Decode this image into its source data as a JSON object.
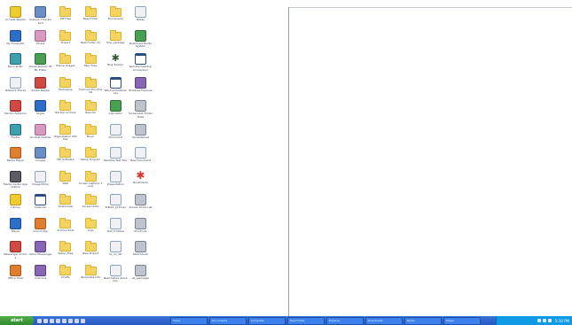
{
  "desktop": {
    "icons": [
      {
        "label": "Acrobat Reader",
        "kind": "yellow"
      },
      {
        "label": "Outlook Thunderbird",
        "kind": "app"
      },
      {
        "label": "ZIP Files",
        "kind": "folder"
      },
      {
        "label": "New Folder",
        "kind": "folder"
      },
      {
        "label": "Documents",
        "kind": "folder"
      },
      {
        "label": "Notes",
        "kind": "doc"
      },
      {
        "label": "My Computer",
        "kind": "blue"
      },
      {
        "label": "Picasa",
        "kind": "pink"
      },
      {
        "label": "Project",
        "kind": "folder"
      },
      {
        "label": "New Folder (2)",
        "kind": "folder"
      },
      {
        "label": "tmp_package",
        "kind": "folder"
      },
      {
        "label": "Download Studio System",
        "kind": "green"
      },
      {
        "label": "Recycle Bin",
        "kind": "teal"
      },
      {
        "label": "Dreamweaver HTML Editor",
        "kind": "green"
      },
      {
        "label": "Online Images",
        "kind": "folder"
      },
      {
        "label": "Misc Files",
        "kind": "folder"
      },
      {
        "label": "Bug Tracker",
        "kind": "bug"
      },
      {
        "label": "Remote Desktop Connection",
        "kind": "window"
      },
      {
        "label": "Network Places",
        "kind": "doc"
      },
      {
        "label": "Adobe Reader",
        "kind": "red"
      },
      {
        "label": "Packaging",
        "kind": "folder"
      },
      {
        "label": "Scanned Documents",
        "kind": "folder"
      },
      {
        "label": "Window Preferences",
        "kind": "window"
      },
      {
        "label": "Windows Explorer",
        "kind": "purple"
      },
      {
        "label": "Norton Antivirus",
        "kind": "red"
      },
      {
        "label": "Skype",
        "kind": "blue"
      },
      {
        "label": "Backup Archive",
        "kind": "folder"
      },
      {
        "label": "Reports",
        "kind": "folder"
      },
      {
        "label": "Calculator",
        "kind": "green"
      },
      {
        "label": "Screenshot Folder Data",
        "kind": "gray"
      },
      {
        "label": "Firefox",
        "kind": "teal"
      },
      {
        "label": "Acrobat Distiller",
        "kind": "pink"
      },
      {
        "label": "Organization Utilities",
        "kind": "folder"
      },
      {
        "label": "Music",
        "kind": "folder"
      },
      {
        "label": "Document",
        "kind": "doc"
      },
      {
        "label": "Spreadsheet",
        "kind": "gray"
      },
      {
        "label": "Media Player",
        "kind": "orange"
      },
      {
        "label": "Images",
        "kind": "app"
      },
      {
        "label": "MP_Software",
        "kind": "folder"
      },
      {
        "label": "Setup Program",
        "kind": "folder"
      },
      {
        "label": "Readme Text Tool",
        "kind": "doc"
      },
      {
        "label": "New Document",
        "kind": "doc"
      },
      {
        "label": "Media Center Application",
        "kind": "dark"
      },
      {
        "label": "Image Editor",
        "kind": "doc"
      },
      {
        "label": "Web",
        "kind": "folder"
      },
      {
        "label": "Screen Capture Tools",
        "kind": "folder"
      },
      {
        "label": "Presentation",
        "kind": "doc"
      },
      {
        "label": "Bookmarks",
        "kind": "star"
      },
      {
        "label": "Library",
        "kind": "yellow"
      },
      {
        "label": "Calendar",
        "kind": "window"
      },
      {
        "label": "Downloads",
        "kind": "folder"
      },
      {
        "label": "Screenshots",
        "kind": "folder"
      },
      {
        "label": "Edited_pictures",
        "kind": "doc"
      },
      {
        "label": "Screen Shots List",
        "kind": "gray"
      },
      {
        "label": "Player",
        "kind": "blue"
      },
      {
        "label": "Sound App",
        "kind": "orange"
      },
      {
        "label": "Archive Root",
        "kind": "folder"
      },
      {
        "label": "Logs",
        "kind": "folder"
      },
      {
        "label": "Text of Notes",
        "kind": "doc"
      },
      {
        "label": "Shortcuts",
        "kind": "gray"
      },
      {
        "label": "Messenger Archive",
        "kind": "red"
      },
      {
        "label": "Yahoo Messenger",
        "kind": "purple"
      },
      {
        "label": "Setup_Files",
        "kind": "folder"
      },
      {
        "label": "New Project",
        "kind": "folder"
      },
      {
        "label": "to_do_list",
        "kind": "doc"
      },
      {
        "label": "Sketchbook",
        "kind": "gray"
      },
      {
        "label": "Office Tools",
        "kind": "orange"
      },
      {
        "label": "Antivirus",
        "kind": "purple"
      },
      {
        "label": "Drafts",
        "kind": "folder"
      },
      {
        "label": "Templates Info",
        "kind": "folder"
      },
      {
        "label": "Read Notes about Doc",
        "kind": "doc"
      },
      {
        "label": "all_packages",
        "kind": "gray"
      }
    ]
  },
  "taskbar": {
    "start_label": "start",
    "quick_launch_count": 8,
    "tasks": [
      "Inbox",
      "Documents",
      "Computer",
      "New Folder",
      "Explorer",
      "Downloads",
      "Notes",
      "Player"
    ],
    "clock": "5:30 PM"
  }
}
